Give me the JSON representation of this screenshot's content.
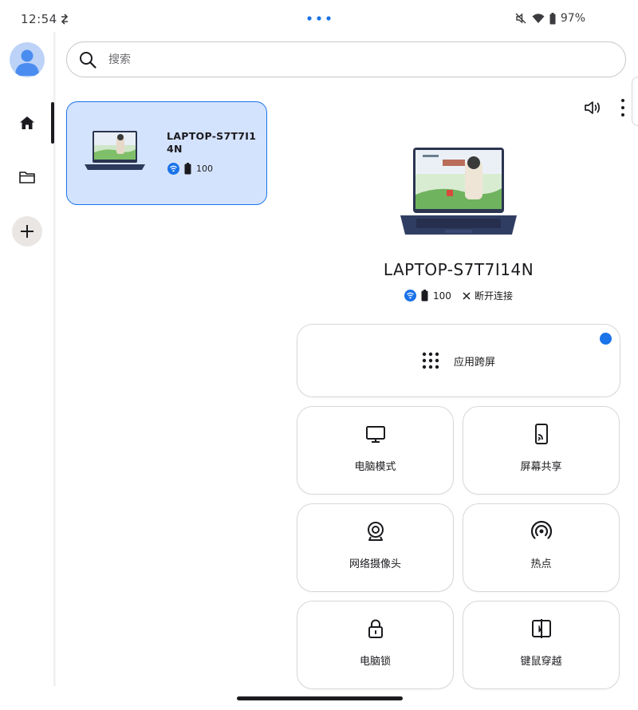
{
  "status_bar": {
    "time": "12:54",
    "battery": "97%",
    "icons": [
      "sync-icon",
      "mute-icon",
      "wifi-icon",
      "battery-icon"
    ]
  },
  "sidebar": {
    "items": [
      {
        "icon": "home-icon",
        "selected": true
      },
      {
        "icon": "folder-icon",
        "selected": false
      },
      {
        "icon": "plus-icon",
        "selected": false
      }
    ]
  },
  "search": {
    "placeholder": "搜索"
  },
  "device_card": {
    "name": "LAPTOP-S7T7I14N",
    "battery": "100",
    "icons": [
      "wifi-icon",
      "battery-icon"
    ]
  },
  "device_detail": {
    "name": "LAPTOP-S7T7I14N",
    "battery": "100",
    "disconnect_label": "断开连接"
  },
  "features": {
    "app_relay": {
      "label": "应用跨屏",
      "icon": "grid-dots-icon",
      "badge_color": "#1a73e8"
    },
    "pc_mode": {
      "label": "电脑模式",
      "icon": "monitor-icon"
    },
    "screen_share": {
      "label": "屏幕共享",
      "icon": "cast-icon"
    },
    "webcam": {
      "label": "网络摄像头",
      "icon": "webcam-icon"
    },
    "hotspot": {
      "label": "热点",
      "icon": "hotspot-icon"
    },
    "pc_lock": {
      "label": "电脑锁",
      "icon": "lock-icon"
    },
    "keyboard_mouse": {
      "label": "键鼠穿越",
      "icon": "cross-device-icon"
    }
  },
  "colors": {
    "accent": "#1a73e8",
    "card_bg": "#d4e3fd",
    "text": "#1b1b1f"
  }
}
